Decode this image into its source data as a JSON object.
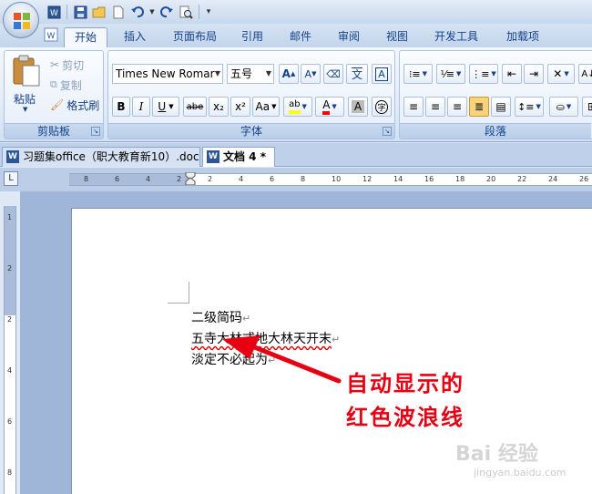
{
  "quick_access": {
    "icons": [
      "word-icon",
      "save-icon",
      "open-icon",
      "new-icon",
      "undo-icon",
      "redo-icon",
      "print-preview-icon",
      "customize-icon"
    ]
  },
  "tabs": [
    {
      "label": "开始",
      "active": true
    },
    {
      "label": "插入"
    },
    {
      "label": "页面布局"
    },
    {
      "label": "引用"
    },
    {
      "label": "邮件"
    },
    {
      "label": "审阅"
    },
    {
      "label": "视图"
    },
    {
      "label": "开发工具"
    },
    {
      "label": "加载项"
    }
  ],
  "clipboard": {
    "paste": "粘贴",
    "cut": "剪切",
    "copy": "复制",
    "format_painter": "格式刷",
    "label": "剪贴板"
  },
  "font": {
    "font_name": "Times New Romar",
    "font_size": "五号",
    "grow": "A",
    "shrink": "A",
    "phonetic": "文",
    "label": "字体",
    "bold": "B",
    "italic": "I",
    "underline": "U",
    "strike": "abe",
    "subscript": "x₂",
    "superscript": "x²",
    "change_case": "Aa",
    "highlight": "ab",
    "font_color": "A",
    "char_shading": "A",
    "enclose": "字"
  },
  "paragraph": {
    "label": "段落"
  },
  "doc_tabs": [
    {
      "label": "习题集office（职大教育新10）.doc"
    },
    {
      "label": "文档 4 *",
      "active": true
    }
  ],
  "ruler": {
    "h_labels": [
      "8",
      "6",
      "4",
      "2",
      "2",
      "4",
      "6",
      "8",
      "10",
      "12",
      "14",
      "16",
      "18",
      "20",
      "22",
      "24",
      "26"
    ],
    "v_labels": [
      "1",
      "2",
      "2",
      "4",
      "6",
      "8"
    ]
  },
  "document": {
    "lines": [
      "二级简码",
      "五寺大林式地大林天开末",
      "淡定不必起为"
    ],
    "mark": "↵"
  },
  "annotation": {
    "line1": "自动显示的",
    "line2": "红色波浪线"
  },
  "watermark": {
    "brand": "Bai 经验",
    "url": "jingyan.baidu.com"
  },
  "colors": {
    "annotation": "#e60012",
    "squiggle": "#e00000",
    "highlight": "#ffff00",
    "font_color": "#ff0000"
  }
}
